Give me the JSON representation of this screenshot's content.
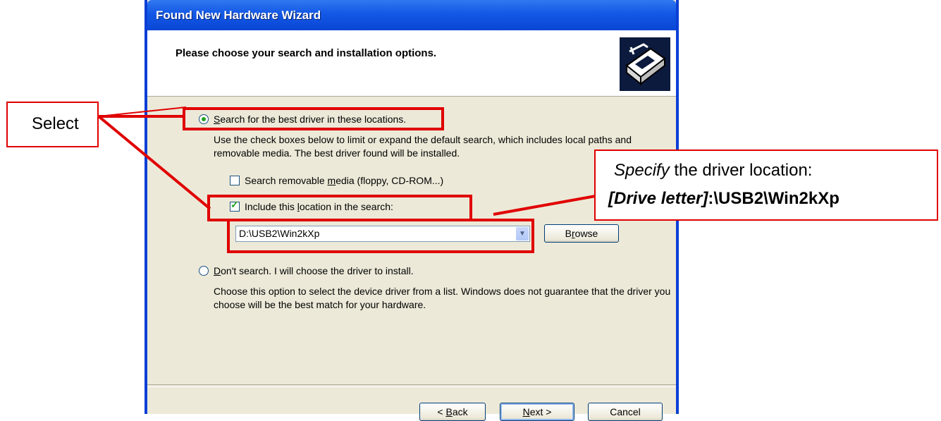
{
  "window": {
    "title": "Found New Hardware Wizard"
  },
  "header": {
    "heading": "Please choose your search and installation options.",
    "icon": "hardware-wizard-icon"
  },
  "options": {
    "search_prefix": "S",
    "search_rest": "earch for the best driver in these locations.",
    "search_selected": true,
    "search_desc": "Use the check boxes below to limit or expand the default search, which includes local paths and removable media. The best driver found will be installed.",
    "removable_pre": "Search removable ",
    "removable_ul": "m",
    "removable_post": "edia (floppy, CD-ROM...)",
    "removable_checked": false,
    "include_pre": "Include this ",
    "include_ul": "l",
    "include_post": "ocation in the search:",
    "include_checked": true,
    "location_value": "D:\\USB2\\Win2kXp",
    "browse_pre": "B",
    "browse_ul": "r",
    "browse_post": "owse",
    "dont_ul": "D",
    "dont_rest": "on't search. I will choose the driver to install.",
    "dont_selected": false,
    "dont_desc": "Choose this option to select the device driver from a list. Windows does not guarantee that the driver you choose will be the best match for your hardware."
  },
  "footer": {
    "back_pre": "< ",
    "back_ul": "B",
    "back_post": "ack",
    "next_ul": "N",
    "next_post": "ext >",
    "cancel": "Cancel"
  },
  "annotations": {
    "select": "Select",
    "specify_italic": "Specify",
    "specify_rest": " the driver location:",
    "drive_letter": "[Drive letter]",
    "drive_path": ":\\USB2\\Win2kXp",
    "accent": "#e00000"
  }
}
